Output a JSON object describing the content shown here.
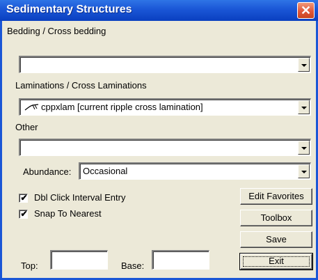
{
  "window": {
    "title": "Sedimentary Structures",
    "close_label": "✕"
  },
  "bedding": {
    "label": "Bedding / Cross bedding",
    "value": ""
  },
  "laminations": {
    "label": "Laminations / Cross Laminations",
    "value": "cppxlam [current ripple cross lamination]",
    "icon": "ripple-lamination-icon"
  },
  "other": {
    "label": "Other",
    "value": ""
  },
  "abundance": {
    "label": "Abundance:",
    "value": "Occasional"
  },
  "options": {
    "dbl_click": {
      "label": "Dbl Click Interval Entry",
      "checked": true
    },
    "snap": {
      "label": "Snap To Nearest",
      "checked": true
    }
  },
  "buttons": {
    "edit_favorites": "Edit Favorites",
    "toolbox": "Toolbox",
    "save": "Save",
    "exit": "Exit"
  },
  "interval": {
    "top_label": "Top:",
    "top_value": "",
    "base_label": "Base:",
    "base_value": ""
  }
}
